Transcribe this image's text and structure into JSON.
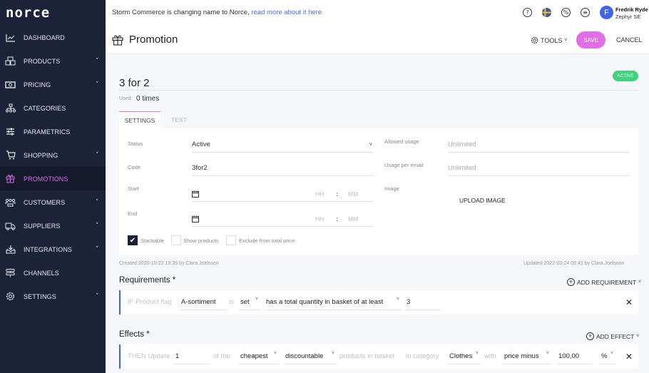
{
  "app": {
    "logo": "norce"
  },
  "sidebar": {
    "items": [
      {
        "label": "DASHBOARD",
        "icon": "chart-line-icon",
        "chevron": false,
        "active": false
      },
      {
        "label": "PRODUCTS",
        "icon": "boxes-icon",
        "chevron": true,
        "active": false
      },
      {
        "label": "PRICING",
        "icon": "money-icon",
        "chevron": true,
        "active": false
      },
      {
        "label": "CATEGORIES",
        "icon": "hierarchy-icon",
        "chevron": false,
        "active": false
      },
      {
        "label": "PARAMETRICS",
        "icon": "sliders-icon",
        "chevron": false,
        "active": false
      },
      {
        "label": "SHOPPING",
        "icon": "cart-icon",
        "chevron": true,
        "active": false
      },
      {
        "label": "PROMOTIONS",
        "icon": "gift-icon",
        "chevron": false,
        "active": true
      },
      {
        "label": "CUSTOMERS",
        "icon": "users-icon",
        "chevron": true,
        "active": false
      },
      {
        "label": "SUPPLIERS",
        "icon": "truck-icon",
        "chevron": true,
        "active": false
      },
      {
        "label": "INTEGRATIONS",
        "icon": "download-box-icon",
        "chevron": true,
        "active": false
      },
      {
        "label": "CHANNELS",
        "icon": "signpost-icon",
        "chevron": false,
        "active": false
      },
      {
        "label": "SETTINGS",
        "icon": "gear-icon",
        "chevron": true,
        "active": false
      }
    ],
    "chevron_glyph": "˅"
  },
  "topbar": {
    "notice_text": "Storm Commerce is changing name to Norce,",
    "notice_link": "read more about it here",
    "icons": [
      "help-icon",
      "flag-sweden-icon",
      "percent-icon",
      "cash-register-icon"
    ],
    "help_glyph": "?",
    "percent_glyph": "%",
    "register_glyph": "≡",
    "user": {
      "initial": "F",
      "name": "Fredrik Ryde",
      "org": "Zephyr SE"
    }
  },
  "header": {
    "title": "Promotion",
    "tools_label": "TOOLS",
    "save_label": "SAVE",
    "cancel_label": "CANCEL"
  },
  "promotion": {
    "name": "3 for 2",
    "status_badge": "ACTIVE",
    "used_label": "Used:",
    "used_value": "0 times"
  },
  "tabs": [
    {
      "label": "SETTINGS",
      "active": true
    },
    {
      "label": "TEXT",
      "active": false
    }
  ],
  "settings": {
    "status": {
      "label": "Status",
      "value": "Active"
    },
    "code": {
      "label": "Code",
      "value": "3for2"
    },
    "start": {
      "label": "Start",
      "hh": "HH",
      "mm": "MM"
    },
    "end": {
      "label": "End",
      "hh": "HH",
      "mm": "MM"
    },
    "colon": ":",
    "allowed_usage": {
      "label": "Allowed usage",
      "placeholder": "Unlimited"
    },
    "usage_per_email": {
      "label": "Usage per email",
      "placeholder": "Unlimited"
    },
    "image": {
      "label": "Image",
      "button": "UPLOAD IMAGE"
    },
    "checkboxes": [
      {
        "label": "Stackable",
        "checked": true
      },
      {
        "label": "Show products",
        "checked": false
      },
      {
        "label": "Exclude from total price",
        "checked": false
      }
    ],
    "check_glyph": "✔"
  },
  "meta": {
    "created": "Created 2020-10-22 19:35 by Clara Joelsson",
    "updated": "Updated 2022-03-24 09:43 by Clara Joelsson"
  },
  "requirements": {
    "title": "Requirements *",
    "add_label": "ADD REQUIREMENT",
    "row": {
      "prefix": "IF Product flag",
      "flag": "A-sortiment",
      "is": "is",
      "state": "set",
      "condition": "has a total quantity in basket of at least",
      "quantity": "3"
    }
  },
  "effects": {
    "title": "Effects *",
    "add_label": "ADD EFFECT",
    "row": {
      "prefix": "THEN Update",
      "count": "1",
      "of_the": "of the",
      "which": "cheapest",
      "kind": "discountable",
      "products_text": "products in basket",
      "in_category": "in category",
      "category": "Clothes",
      "with": "with",
      "operation": "price minus",
      "amount": "100,00",
      "unit": "%"
    }
  },
  "glyphs": {
    "dropdown": "˅",
    "close": "✕",
    "plus": "+"
  },
  "colors": {
    "sidebar_bg": "#1c2339",
    "accent": "#e26ee6",
    "active_badge": "#3ed47a",
    "link": "#4a6cf7",
    "rule_border": "#3e63ee"
  }
}
